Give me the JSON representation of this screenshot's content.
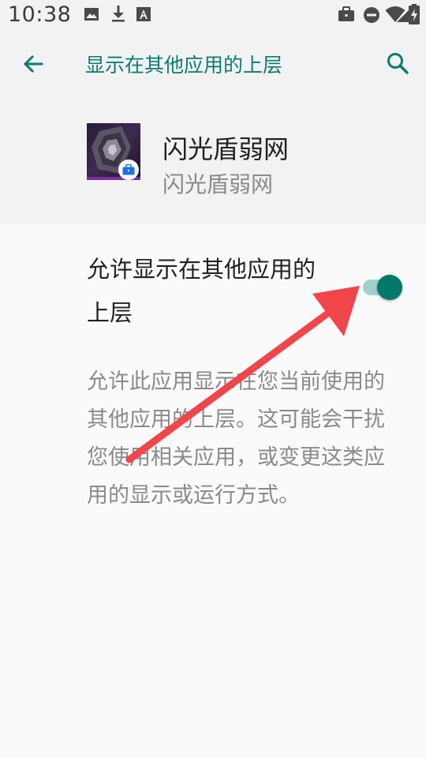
{
  "status_bar": {
    "time": "10:38",
    "left_icons": [
      "image-icon",
      "download-icon",
      "font-icon"
    ],
    "right_icons": [
      "briefcase-icon",
      "dnd-icon",
      "wifi-icon",
      "signal-icon",
      "battery-icon"
    ]
  },
  "app_bar": {
    "title": "显示在其他应用的上层",
    "back_icon": "arrow-back-icon",
    "search_icon": "search-icon"
  },
  "app_header": {
    "name": "闪光盾弱网",
    "subtitle": "闪光盾弱网"
  },
  "setting": {
    "title": "允许显示在其他应用的上层",
    "toggle_on": true
  },
  "description": "允许此应用显示在您当前使用的其他应用的上层。这可能会干扰您使用相关应用，或变更这类应用的显示或运行方式。",
  "colors": {
    "accent": "#00796b",
    "title_teal": "#0a7c72",
    "annotation_arrow": "#f0454a"
  }
}
